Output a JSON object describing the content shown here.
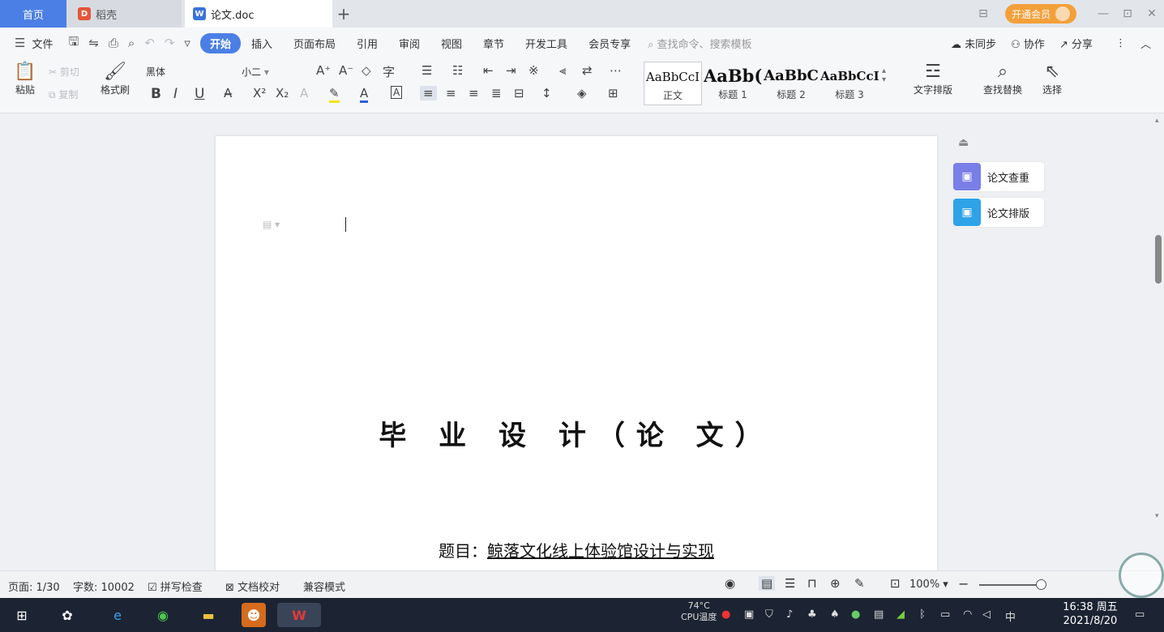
{
  "tabs": {
    "home": "首页",
    "dao": "稻壳",
    "doc": "论文.doc",
    "add": "+"
  },
  "member": {
    "label": "开通会员"
  },
  "window": {
    "min": "—",
    "max": "⊡",
    "close": "✕",
    "layout": "⊟"
  },
  "menu": {
    "file": "文件",
    "items": [
      "开始",
      "插入",
      "页面布局",
      "引用",
      "审阅",
      "视图",
      "章节",
      "开发工具",
      "会员专享"
    ],
    "search_placeholder": "查找命令、搜索模板",
    "sync": "未同步",
    "collab": "协作",
    "share": "分享",
    "more": "⋮",
    "collapse": "︿"
  },
  "ribbon": {
    "paste": "粘贴",
    "cut": "剪切",
    "copy": "复制",
    "format_painter": "格式刷",
    "font_name": "黑体",
    "font_size": "小二",
    "styles": [
      {
        "sample": "AaBbCcI",
        "label": "正文"
      },
      {
        "sample": "AaBb(",
        "label": "标题 1"
      },
      {
        "sample": "AaBbC",
        "label": "标题 2"
      },
      {
        "sample": "AaBbCcI",
        "label": "标题 3"
      }
    ],
    "text_layout": "文字排版",
    "find_replace": "查找替换",
    "select": "选择"
  },
  "document": {
    "title": "毕 业 设 计（论 文）",
    "subject_prefix": "题目：",
    "subject": "鲸落文化线上体验馆设计与实现"
  },
  "side_panel": {
    "check": "论文查重",
    "layout": "论文排版"
  },
  "status": {
    "page": "页面: 1/30",
    "words": "字数: 10002",
    "spell": "拼写检查",
    "proofread": "文档校对",
    "compat": "兼容模式",
    "zoom": "100%",
    "zoom_level": 1.0
  },
  "taskbar": {
    "cpu_temp": "74°C",
    "cpu_label": "CPU温度",
    "ime": "中",
    "time": "16:38 周五",
    "date": "2021/8/20"
  },
  "colors": {
    "accent": "#4b7fe6",
    "member": "#f3a03a",
    "taskbar": "#1c2433"
  }
}
